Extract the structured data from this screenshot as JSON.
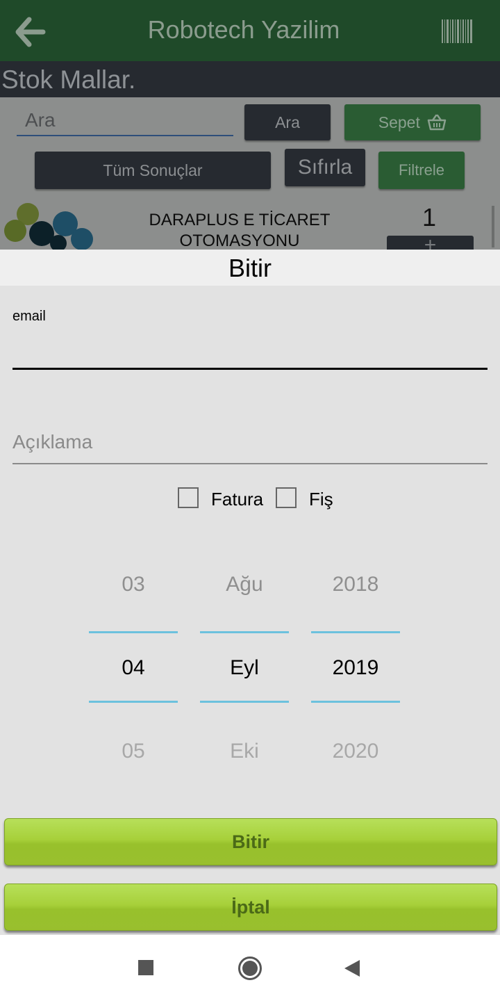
{
  "appbar": {
    "title": "Robotech Yazilim",
    "back_icon": "arrow-left-icon",
    "barcode_icon": "barcode-icon"
  },
  "section": {
    "title": "Stok Mallar."
  },
  "search": {
    "placeholder": "Ara",
    "search_button": "Ara",
    "cart_button": "Sepet",
    "cart_icon": "basket-icon",
    "all_results_button": "Tüm Sonuçlar",
    "reset_button": "Sıfırla",
    "filter_button": "Filtrele"
  },
  "product": {
    "name": "DARAPLUS E TİCARET OTOMASYONU",
    "quantity": "1",
    "add_button": "+"
  },
  "dialog": {
    "title": "Bitir",
    "email_label": "email",
    "email_value": "",
    "description_placeholder": "Açıklama",
    "description_value": "",
    "checkboxes": [
      {
        "label": "Fatura",
        "checked": false
      },
      {
        "label": "Fiş",
        "checked": false
      }
    ],
    "date_picker": {
      "day": {
        "prev": "03",
        "selected": "04",
        "next": "05"
      },
      "month": {
        "prev": "Ağu",
        "selected": "Eyl",
        "next": "Eki"
      },
      "year": {
        "prev": "2018",
        "selected": "2019",
        "next": "2020"
      }
    },
    "finish_button": "Bitir",
    "cancel_button": "İptal"
  },
  "colors": {
    "appbar": "#1f4a29",
    "section_bar": "#262a30",
    "picker_divider": "#6cc1dd",
    "action_button": "#a7d03a"
  },
  "navbar": {
    "recents_icon": "square-recents-icon",
    "home_icon": "circle-home-icon",
    "back_icon": "triangle-back-icon"
  }
}
